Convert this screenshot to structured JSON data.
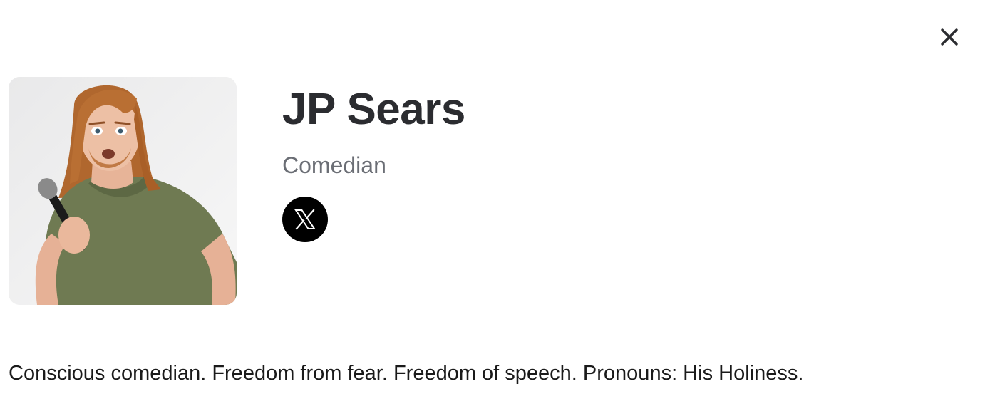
{
  "modal": {
    "close_icon": "close-icon"
  },
  "profile": {
    "name": "JP Sears",
    "role": "Comedian",
    "photo_icon": "person-photo",
    "social": [
      {
        "icon": "x-logo-icon",
        "network": "X"
      }
    ],
    "bio": "Conscious comedian. Freedom from fear. Freedom of speech. Pronouns: His Holiness."
  },
  "colors": {
    "name_text": "#2b2c30",
    "role_text": "#6b6e75",
    "social_bg": "#000000",
    "bio_text": "#1a1a1a"
  }
}
